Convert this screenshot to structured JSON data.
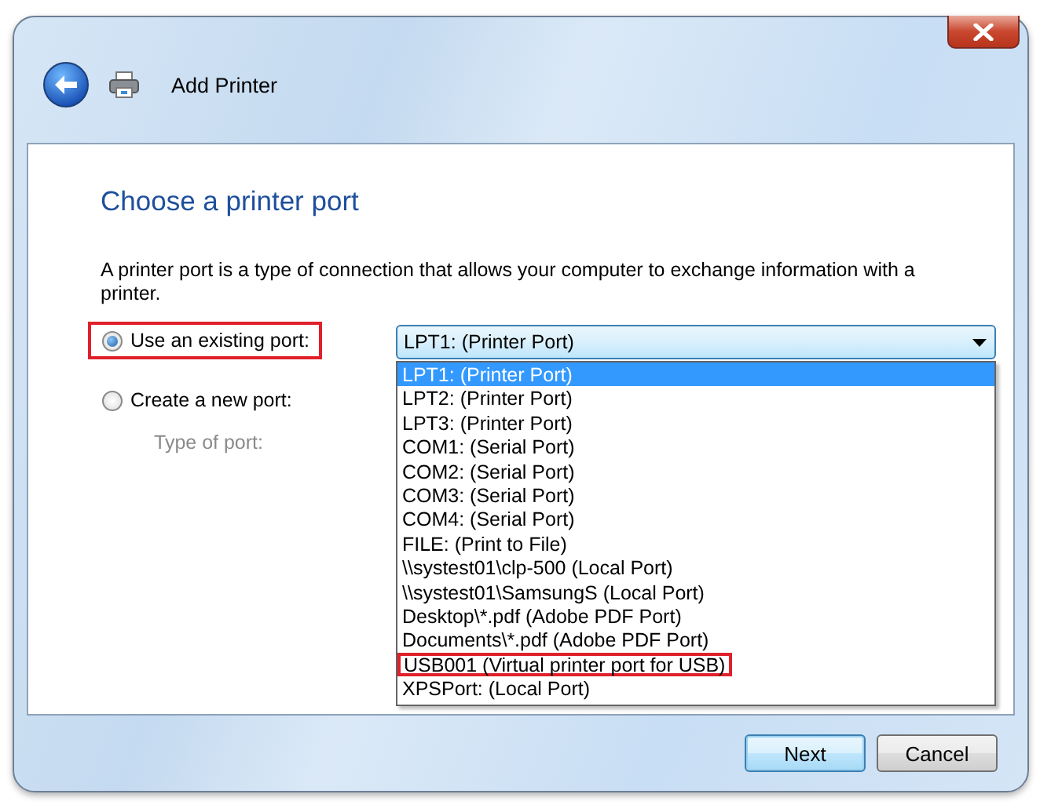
{
  "window": {
    "title": "Add Printer"
  },
  "heading": "Choose a printer port",
  "description": "A printer port is a type of connection that allows your computer to exchange information with a printer.",
  "port_options": [
    {
      "label": "Use an existing port:",
      "selected": true,
      "highlighted": true
    },
    {
      "label": "Create a new port:",
      "selected": false,
      "highlighted": false
    }
  ],
  "type_of_port": {
    "label": "Type of port:",
    "disabled": true
  },
  "port_dropdown": {
    "value": "LPT1: (Printer Port)",
    "expanded": true,
    "options": [
      {
        "label": "LPT1: (Printer Port)",
        "selected": true,
        "highlighted": false
      },
      {
        "label": "LPT2: (Printer Port)",
        "selected": false,
        "highlighted": false
      },
      {
        "label": "LPT3: (Printer Port)",
        "selected": false,
        "highlighted": false
      },
      {
        "label": "COM1: (Serial Port)",
        "selected": false,
        "highlighted": false
      },
      {
        "label": "COM2: (Serial Port)",
        "selected": false,
        "highlighted": false
      },
      {
        "label": "COM3: (Serial Port)",
        "selected": false,
        "highlighted": false
      },
      {
        "label": "COM4: (Serial Port)",
        "selected": false,
        "highlighted": false
      },
      {
        "label": "FILE: (Print to File)",
        "selected": false,
        "highlighted": false
      },
      {
        "label": "\\\\systest01\\clp-500 (Local Port)",
        "selected": false,
        "highlighted": false
      },
      {
        "label": "\\\\systest01\\SamsungS (Local Port)",
        "selected": false,
        "highlighted": false
      },
      {
        "label": "Desktop\\*.pdf (Adobe PDF Port)",
        "selected": false,
        "highlighted": false
      },
      {
        "label": "Documents\\*.pdf (Adobe PDF Port)",
        "selected": false,
        "highlighted": false
      },
      {
        "label": "USB001 (Virtual printer port for USB)",
        "selected": false,
        "highlighted": true
      },
      {
        "label": "XPSPort: (Local Port)",
        "selected": false,
        "highlighted": false
      }
    ]
  },
  "buttons": [
    {
      "label": "Next",
      "default": true
    },
    {
      "label": "Cancel",
      "default": false
    }
  ]
}
